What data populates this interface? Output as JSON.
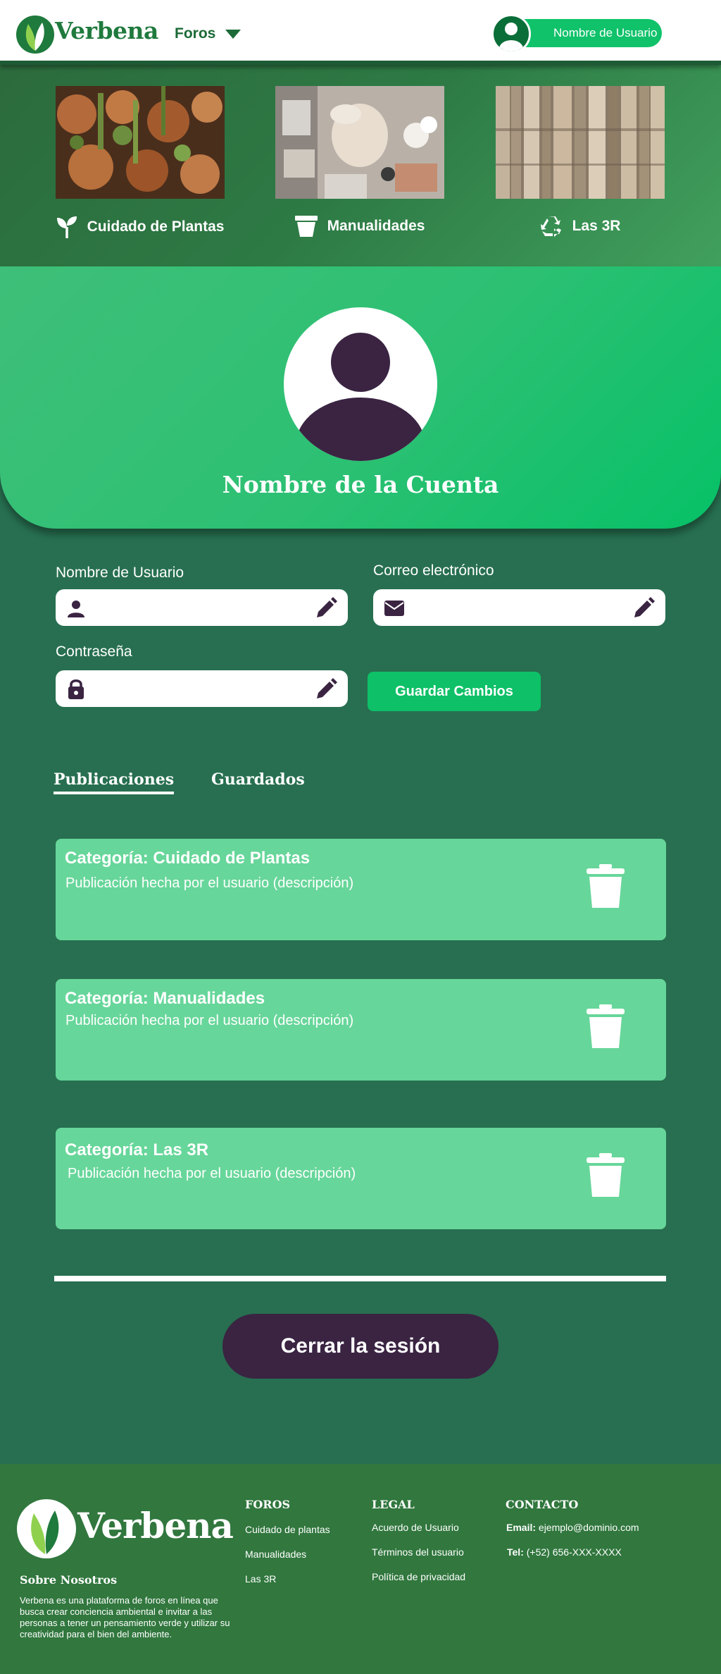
{
  "header": {
    "logo_text": "Verbena",
    "nav_foros": "Foros",
    "user_name": "Nombre de Usuario"
  },
  "categories": [
    {
      "label": "Cuidado de Plantas",
      "icon": "sprout-icon"
    },
    {
      "label": "Manualidades",
      "icon": "pot-icon"
    },
    {
      "label": "Las 3R",
      "icon": "recycle-icon"
    }
  ],
  "profile": {
    "account_name": "Nombre de la Cuenta"
  },
  "form": {
    "username_label": "Nombre de Usuario",
    "username_value": "",
    "email_label": "Correo electrónico",
    "email_value": "",
    "password_label": "Contraseña",
    "password_value": "",
    "save_label": "Guardar Cambios"
  },
  "tabs": [
    {
      "label": "Publicaciones",
      "active": true
    },
    {
      "label": "Guardados",
      "active": false
    }
  ],
  "posts": [
    {
      "title": "Categoría: Cuidado de Plantas",
      "description": "Publicación hecha por el usuario (descripción)"
    },
    {
      "title": "Categoría: Manualidades",
      "description": "Publicación hecha por el usuario (descripción)"
    },
    {
      "title": "Categoría: Las 3R",
      "description": "Publicación hecha por el usuario (descripción)"
    }
  ],
  "logout_label": "Cerrar la sesión",
  "footer": {
    "logo_text": "Verbena",
    "about_title": "Sobre Nosotros",
    "about_text": "Verbena es una plataforma de foros en línea que busca crear conciencia ambiental e invitar a las personas a tener un pensamiento verde y utilizar su creatividad para el bien del ambiente.",
    "foros_title": "FOROS",
    "foros_links": [
      "Cuidado de plantas",
      "Manualidades",
      "Las 3R"
    ],
    "legal_title": "LEGAL",
    "legal_links": [
      "Acuerdo de Usuario",
      "Términos del usuario",
      "Política de privacidad"
    ],
    "contact_title": "CONTACTO",
    "email_label": "Email:",
    "email_value": "ejemplo@dominio.com",
    "tel_label": "Tel:",
    "tel_value": "(+52) 656-XXX-XXXX"
  },
  "colors": {
    "brand_green": "#1f7a3d",
    "accent_green": "#10c26a",
    "post_card": "#67d69a",
    "dark_purple": "#3a2442",
    "page_bg": "#276f50"
  }
}
